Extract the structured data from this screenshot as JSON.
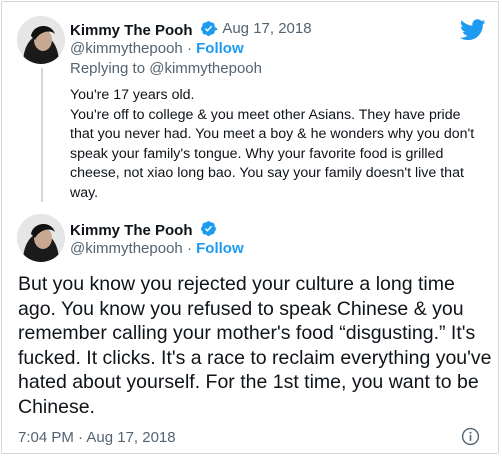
{
  "tweet1": {
    "display_name": "Kimmy The Pooh",
    "date": "· Aug 17, 2018",
    "handle": "@kimmythepooh",
    "separator": "·",
    "follow_label": "Follow",
    "replying_prefix": "Replying to",
    "replying_to": "@kimmythepooh",
    "text_line1": "You're 17 years old.",
    "text_body": "You're off to college & you meet other Asians. They have pride that you never had. You meet a boy & he wonders why you don't speak your family's tongue. Why your favorite food is grilled cheese, not xiao long bao. You say your family doesn't live that way."
  },
  "tweet2": {
    "display_name": "Kimmy The Pooh",
    "handle": "@kimmythepooh",
    "separator": "·",
    "follow_label": "Follow",
    "text": "But you know you rejected your culture a long time ago. You know you refused to speak Chinese & you remember calling your mother's food “disgusting.” It's fucked. It clicks. It's a race to reclaim everything you've hated about yourself. For the 1st time, you want to be Chinese.",
    "timestamp": "7:04 PM · Aug 17, 2018"
  },
  "colors": {
    "accent": "#1d9bf0",
    "text": "#0f1419",
    "muted": "#536471",
    "border": "#cfd9de"
  },
  "icons": [
    "twitter-bird-icon",
    "verified-badge-icon",
    "info-icon"
  ]
}
